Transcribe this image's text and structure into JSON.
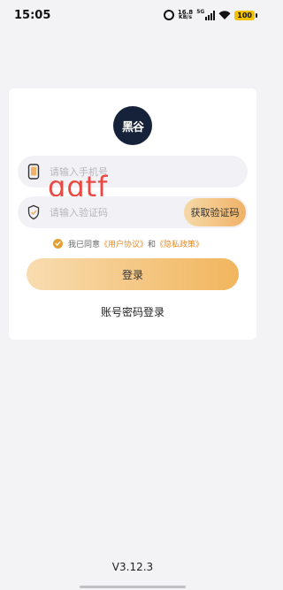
{
  "status_bar": {
    "time": "15:05",
    "speed_value": "16.8",
    "speed_unit": "KB/s",
    "network": "5G",
    "battery": "100",
    "icons": [
      "alarm-icon",
      "signal-icon",
      "wifi-icon",
      "battery-icon"
    ]
  },
  "logo": {
    "text": "黑谷"
  },
  "phone_field": {
    "placeholder": "请输入手机号",
    "value": ""
  },
  "code_field": {
    "placeholder": "请输入验证码",
    "value": "",
    "get_code_label": "获取验证码"
  },
  "watermark": "qqtf",
  "agreement": {
    "checked": true,
    "prefix": "我已同意",
    "user_agreement": "《用户协议》",
    "and": "和",
    "privacy_policy": "《隐私政策》"
  },
  "login_button": "登录",
  "account_login_link": "账号密码登录",
  "version": "V3.12.3",
  "colors": {
    "accent": "#f1b55d",
    "link": "#e58c2b",
    "check": "#e4a036",
    "logo_bg": "#16213a"
  }
}
